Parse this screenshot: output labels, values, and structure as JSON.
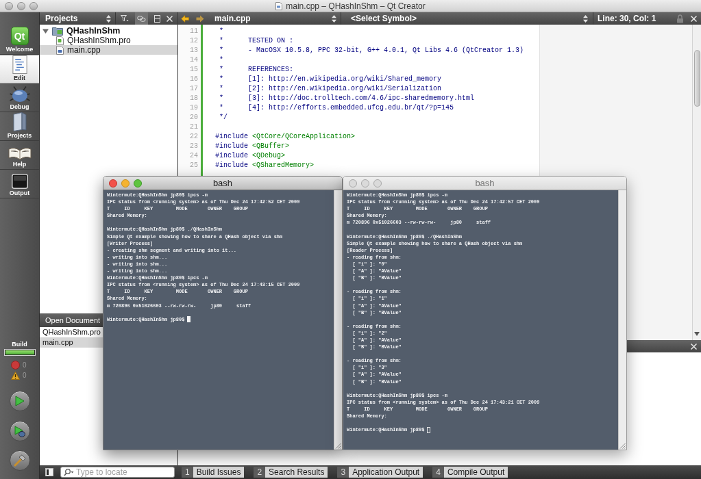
{
  "window": {
    "title": "main.cpp – QHashInShm – Qt Creator"
  },
  "mode_bar": {
    "modes": [
      {
        "kind": "welcome",
        "label": "Welcome",
        "logo_text": "Qt",
        "selected": false
      },
      {
        "kind": "edit",
        "label": "Edit",
        "selected": true
      },
      {
        "kind": "debug",
        "label": "Debug",
        "selected": false
      },
      {
        "kind": "projects",
        "label": "Projects",
        "selected": false
      },
      {
        "kind": "help",
        "label": "Help",
        "selected": false
      },
      {
        "kind": "output",
        "label": "Output",
        "selected": false
      }
    ],
    "build": {
      "label": "Build",
      "level": 1,
      "errors": "0",
      "warnings": "0"
    }
  },
  "projects_pane": {
    "title": "Projects",
    "link_toggle_on": true,
    "tree": [
      {
        "kind": "project",
        "label": "QHashInShm",
        "expanded": true,
        "selected": false,
        "children": [
          {
            "kind": "pro",
            "label": "QHashInShm.pro",
            "selected": false
          },
          {
            "kind": "cpp",
            "label": "main.cpp",
            "selected": true
          }
        ]
      }
    ]
  },
  "open_documents": {
    "title": "Open Document",
    "items": [
      {
        "label": "QHashInShm.pro",
        "selected": false
      },
      {
        "label": "main.cpp",
        "selected": true
      }
    ]
  },
  "editor": {
    "file": "main.cpp",
    "symbol": "<Select Symbol>",
    "cursor_position": "Line: 30, Col: 1",
    "lines": [
      {
        "number": "11",
        "parts": [
          {
            "kind": "comment",
            "text": " *"
          }
        ]
      },
      {
        "number": "12",
        "parts": [
          {
            "kind": "comment",
            "text": " *      TESTED ON :"
          }
        ]
      },
      {
        "number": "13",
        "parts": [
          {
            "kind": "comment",
            "text": " *      - MacOSX 10.5.8, PPC 32-bit, G++ 4.0.1, Qt Libs 4.6 (QtCreator 1.3)"
          }
        ]
      },
      {
        "number": "14",
        "parts": [
          {
            "kind": "comment",
            "text": " *"
          }
        ]
      },
      {
        "number": "15",
        "parts": [
          {
            "kind": "comment",
            "text": " *      REFERENCES:"
          }
        ]
      },
      {
        "number": "16",
        "parts": [
          {
            "kind": "comment",
            "text": " *      [1]: http://en.wikipedia.org/wiki/Shared_memory"
          }
        ]
      },
      {
        "number": "17",
        "parts": [
          {
            "kind": "comment",
            "text": " *      [2]: http://en.wikipedia.org/wiki/Serialization"
          }
        ]
      },
      {
        "number": "18",
        "parts": [
          {
            "kind": "comment",
            "text": " *      [3]: http://doc.trolltech.com/4.6/ipc-sharedmemory.html"
          }
        ]
      },
      {
        "number": "19",
        "parts": [
          {
            "kind": "comment",
            "text": " *      [4]: http://efforts.embedded.ufcg.edu.br/qt/?p=145"
          }
        ]
      },
      {
        "number": "20",
        "parts": [
          {
            "kind": "comment",
            "text": " */"
          }
        ]
      },
      {
        "number": "21"
      },
      {
        "number": "22",
        "parts": [
          {
            "kind": "preprocessor",
            "text": "#include "
          },
          {
            "kind": "string",
            "text": "<QtCore/QCoreApplication>"
          }
        ]
      },
      {
        "number": "23",
        "parts": [
          {
            "kind": "preprocessor",
            "text": "#include "
          },
          {
            "kind": "string",
            "text": "<QBuffer>"
          }
        ]
      },
      {
        "number": "24",
        "parts": [
          {
            "kind": "preprocessor",
            "text": "#include "
          },
          {
            "kind": "string",
            "text": "<QDebug>"
          }
        ]
      },
      {
        "number": "25",
        "parts": [
          {
            "kind": "preprocessor",
            "text": "#include "
          },
          {
            "kind": "string",
            "text": "<QSharedMemory>"
          }
        ]
      }
    ]
  },
  "terminals": [
    {
      "title": "bash",
      "active": true,
      "blocks": [
        [
          "Wintermute:QHashInShm jp80$ ipcs -m",
          "IPC status from <running system> as of Thu Dec 24 17:42:52 CET 2009",
          "T     ID     KEY        MODE       OWNER    GROUP",
          "Shared Memory:"
        ],
        [
          "Wintermute:QHashInShm jp80$ ./QHashInShm",
          "Simple Qt example showing how to share a QHash object via shm",
          "[Writer Process]",
          "- creating shm segment and writing into it...",
          "- writing into shm...",
          "- writing into shm...",
          "- writing into shm...",
          "Wintermute:QHashInShm jp80$ ipcs -m",
          "IPC status from <running system> as of Thu Dec 24 17:43:15 CET 2009",
          "T     ID     KEY        MODE       OWNER    GROUP",
          "Shared Memory:",
          "m 720896 0x51026603 --rw-rw-rw-     jp80     staff"
        ],
        [
          "Wintermute:QHashInShm jp80$"
        ]
      ]
    },
    {
      "title": "bash",
      "active": false,
      "blocks": [
        [
          "Wintermute:QHashInShm jp80$ ipcs -m",
          "IPC status from <running system> as of Thu Dec 24 17:42:57 CET 2009",
          "T     ID     KEY        MODE       OWNER    GROUP",
          "Shared Memory:",
          "m 720896 0x51026603 --rw-rw-rw-     jp80     staff"
        ],
        [
          "Wintermute:QHashInShm jp80$ ./QHashInShm",
          "Simple Qt example showing how to share a QHash object via shm",
          "[Reader Process]",
          "- reading from shm:",
          "  [ \"i\" ]: \"0\"",
          "  [ \"A\" ]: \"AValue\"",
          "  [ \"B\" ]: \"BValue\""
        ],
        [
          "- reading from shm:",
          "  [ \"i\" ]: \"1\"",
          "  [ \"A\" ]: \"AValue\"",
          "  [ \"B\" ]: \"BValue\""
        ],
        [
          "- reading from shm:",
          "  [ \"i\" ]: \"2\"",
          "  [ \"A\" ]: \"AValue\"",
          "  [ \"B\" ]: \"BValue\""
        ],
        [
          "- reading from shm:",
          "  [ \"i\" ]: \"3\"",
          "  [ \"A\" ]: \"AValue\"",
          "  [ \"B\" ]: \"BValue\""
        ],
        [
          "Wintermute:QHashInShm jp80$ ipcs -m",
          "IPC status from <running system> as of Thu Dec 24 17:43:21 CET 2009",
          "T     ID     KEY        MODE       OWNER    GROUP",
          "Shared Memory:"
        ],
        [
          "Wintermute:QHashInShm jp80$"
        ]
      ]
    }
  ],
  "status_bar": {
    "locate_placeholder": "Type to locate",
    "tabs": [
      {
        "number": "1",
        "label": "Build Issues",
        "selected": false
      },
      {
        "number": "2",
        "label": "Search Results",
        "selected": false
      },
      {
        "number": "3",
        "label": "Application Output",
        "selected": false
      },
      {
        "number": "4",
        "label": "Compile Output",
        "selected": false
      }
    ]
  }
}
